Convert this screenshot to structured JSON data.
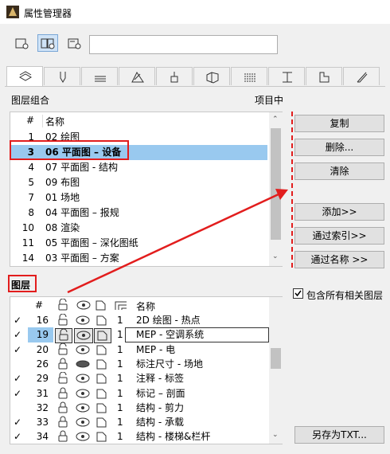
{
  "window": {
    "title": "属性管理器"
  },
  "tabs": [
    "layers",
    "pen",
    "fill",
    "surface",
    "brush",
    "building",
    "texture",
    "column",
    "profile",
    "pencil"
  ],
  "left_top": {
    "label": "图层组合",
    "right_label": "项目中"
  },
  "combo_list": {
    "headers": {
      "num": "#",
      "name": "名称"
    },
    "rows": [
      {
        "num": "1",
        "name": "02 绘图",
        "selected": false
      },
      {
        "num": "3",
        "name": "06 平面图 – 设备",
        "selected": true
      },
      {
        "num": "4",
        "name": "07 平面图 - 结构",
        "selected": false
      },
      {
        "num": "5",
        "name": "09 布图",
        "selected": false
      },
      {
        "num": "7",
        "name": "01 场地",
        "selected": false
      },
      {
        "num": "8",
        "name": "04 平面图 – 报规",
        "selected": false
      },
      {
        "num": "10",
        "name": "08 渲染",
        "selected": false
      },
      {
        "num": "11",
        "name": "05 平面图 – 深化图纸",
        "selected": false
      },
      {
        "num": "14",
        "name": "03 平面图 – 方案",
        "selected": false
      }
    ]
  },
  "right_buttons": {
    "copy": "复制",
    "delete": "删除...",
    "clear": "清除",
    "add": "添加>>",
    "by_index": "通过索引>>",
    "by_name": "通过名称 >>"
  },
  "layers": {
    "label": "图层",
    "include_label": "包含所有相关图层",
    "include_checked": true,
    "headers": {
      "num": "#",
      "name": "名称"
    },
    "rows": [
      {
        "check": true,
        "num": "16",
        "lock": "open",
        "vis": "eye",
        "cnt": "1",
        "name": "2D 绘图 - 热点",
        "selected": false
      },
      {
        "check": true,
        "num": "19",
        "lock": "open",
        "vis": "eye",
        "cnt": "1",
        "name": "MEP - 空调系统",
        "selected": true
      },
      {
        "check": true,
        "num": "20",
        "lock": "open",
        "vis": "eye",
        "cnt": "1",
        "name": "MEP - 电",
        "selected": false
      },
      {
        "check": false,
        "num": "26",
        "lock": "closed",
        "vis": "hidden",
        "cnt": "1",
        "name": "标注尺寸 - 场地",
        "selected": false
      },
      {
        "check": true,
        "num": "29",
        "lock": "open",
        "vis": "eye",
        "cnt": "1",
        "name": "注释 - 标签",
        "selected": false
      },
      {
        "check": true,
        "num": "31",
        "lock": "closed",
        "vis": "eye",
        "cnt": "1",
        "name": "标记 – 剖面",
        "selected": false
      },
      {
        "check": false,
        "num": "32",
        "lock": "closed",
        "vis": "eye",
        "cnt": "1",
        "name": "结构 - 剪力",
        "selected": false
      },
      {
        "check": true,
        "num": "33",
        "lock": "closed",
        "vis": "eye",
        "cnt": "1",
        "name": "结构 - 承载",
        "selected": false
      },
      {
        "check": true,
        "num": "34",
        "lock": "closed",
        "vis": "eye",
        "cnt": "1",
        "name": "结构 - 楼梯&栏杆",
        "selected": false
      }
    ]
  },
  "save_txt": "另存为TXT..."
}
